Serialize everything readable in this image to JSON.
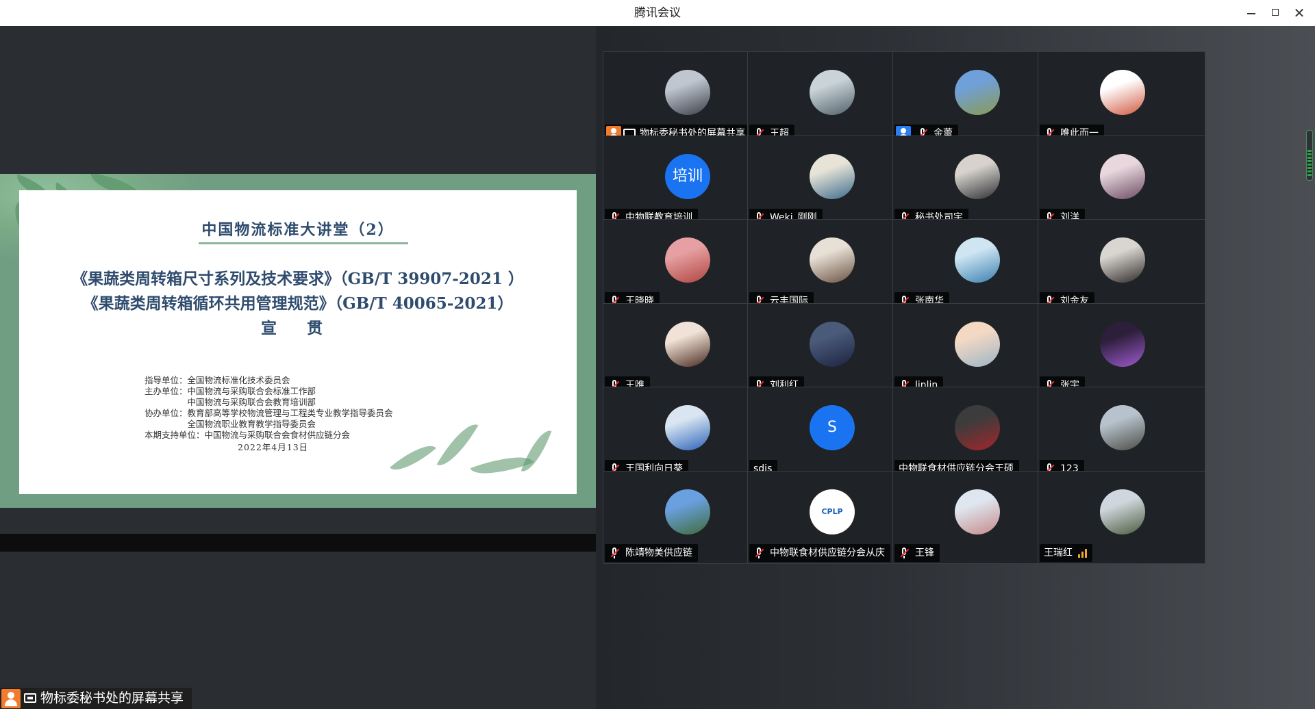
{
  "window": {
    "title": "腾讯会议"
  },
  "share": {
    "label": "物标委秘书处的屏幕共享",
    "slide": {
      "title": "中国物流标准大讲堂（2）",
      "line1": "《果蔬类周转箱尺寸系列及技术要求》（GB/T 39907-2021 ）",
      "line2": "《果蔬类周转箱循环共用管理规范》（GB/T 40065-2021）",
      "line3": "宣 贯",
      "info": [
        "指导单位：全国物流标准化技术委员会",
        "主办单位：中国物流与采购联合会标准工作部",
        "　　　　　中国物流与采购联合会教育培训部",
        "协办单位：教育部高等学校物流管理与工程类专业教学指导委员会",
        "　　　　　全国物流职业教育教学指导委员会",
        "本期支持单位：中国物流与采购联合会食材供应链分会"
      ],
      "date": "2022年4月13日"
    }
  },
  "participants": [
    {
      "name": "物标委秘书处的屏幕共享",
      "avatar": "photo",
      "colors": [
        "#bfc6cf",
        "#3b4049"
      ],
      "badge": "orange-screen",
      "mic": false
    },
    {
      "name": "王超",
      "avatar": "photo",
      "colors": [
        "#c9d3d8",
        "#51606a"
      ],
      "mic": true
    },
    {
      "name": "金蕾",
      "avatar": "photo",
      "colors": [
        "#6fa0d9",
        "#8b9a52"
      ],
      "badge": "blue",
      "mic": true
    },
    {
      "name": "唯此而一",
      "avatar": "photo",
      "colors": [
        "#ffffff",
        "#d1583f"
      ],
      "mic": true
    },
    {
      "name": "中物联教育培训",
      "avatar": "text",
      "text": "培训",
      "colors": [
        "#1a74f2",
        "#1a74f2"
      ],
      "mic": true
    },
    {
      "name": "Weki_刚刚",
      "avatar": "photo",
      "colors": [
        "#e7e4d7",
        "#3d6b8c"
      ],
      "mic": true
    },
    {
      "name": "秘书处司宇",
      "avatar": "photo",
      "colors": [
        "#d7d3cc",
        "#2d2f33"
      ],
      "mic": true
    },
    {
      "name": "刘洋",
      "avatar": "photo",
      "colors": [
        "#e8d8de",
        "#6b4b62"
      ],
      "mic": true
    },
    {
      "name": "王晓晓",
      "avatar": "photo",
      "colors": [
        "#e6a0a3",
        "#b0453f"
      ],
      "mic": true
    },
    {
      "name": "云丰国际",
      "avatar": "photo",
      "colors": [
        "#e8e0d6",
        "#6a5243"
      ],
      "mic": true
    },
    {
      "name": "张南华",
      "avatar": "photo",
      "colors": [
        "#cfe6f2",
        "#3a7fb0"
      ],
      "mic": true
    },
    {
      "name": "刘金友",
      "avatar": "photo",
      "colors": [
        "#d9d6d2",
        "#2f2a27"
      ],
      "mic": true
    },
    {
      "name": "王唯",
      "avatar": "photo",
      "colors": [
        "#f0e2d6",
        "#4a2a20"
      ],
      "mic": true
    },
    {
      "name": "刘利红",
      "avatar": "photo",
      "colors": [
        "#4a5a7a",
        "#1c2340"
      ],
      "mic": true
    },
    {
      "name": "linlin",
      "avatar": "photo",
      "colors": [
        "#f3d8c4",
        "#9bb6c4"
      ],
      "mic": true
    },
    {
      "name": "张宇",
      "avatar": "photo",
      "colors": [
        "#2d1f3b",
        "#a05ad1"
      ],
      "mic": true
    },
    {
      "name": "王国利向日葵",
      "avatar": "photo",
      "colors": [
        "#d9e6f2",
        "#2a62b8"
      ],
      "mic": true
    },
    {
      "name": "sdis",
      "avatar": "text",
      "text": "S",
      "colors": [
        "#1a74f2",
        "#1a74f2"
      ],
      "mic": false
    },
    {
      "name": "中物联食材供应链分会王硕",
      "avatar": "photo",
      "colors": [
        "#3c3c3c",
        "#a3262b"
      ],
      "mic": false
    },
    {
      "name": "123",
      "avatar": "photo",
      "colors": [
        "#b7c2cc",
        "#4a4c44"
      ],
      "mic": true
    },
    {
      "name": "陈靖物美供应链",
      "avatar": "photo",
      "colors": [
        "#6aa0e0",
        "#3f6b3a"
      ],
      "mic": true
    },
    {
      "name": "中物联食材供应链分会从庆",
      "avatar": "logo",
      "text": "CPLP",
      "colors": [
        "#ffffff",
        "#1d62b8"
      ],
      "mic": true
    },
    {
      "name": "王锋",
      "avatar": "photo",
      "colors": [
        "#dfe6ef",
        "#c48a8a"
      ],
      "mic": true
    },
    {
      "name": "王瑞红",
      "avatar": "photo",
      "colors": [
        "#cfd6dd",
        "#4a5b3d"
      ],
      "mic": false,
      "signal": true
    }
  ],
  "colors": {
    "accent_blue": "#1a74f2",
    "share_badge": "#f27c2b",
    "muted_mic": "#e33333",
    "signal": "#f2a23a"
  }
}
